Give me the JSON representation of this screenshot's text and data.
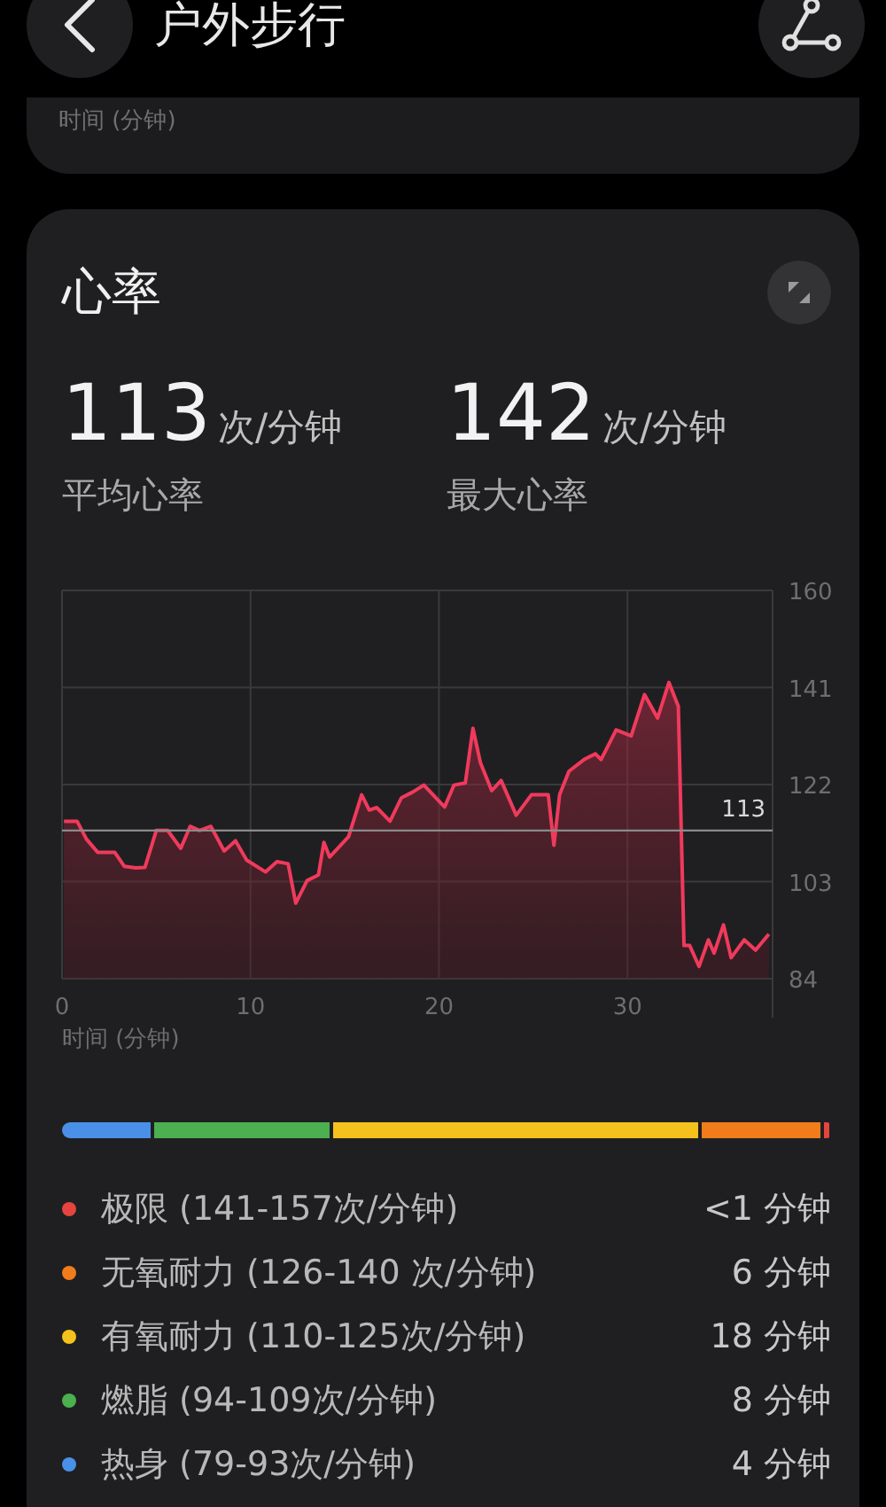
{
  "header": {
    "title": "户外步行"
  },
  "previous_card": {
    "axis_label": "时间 (分钟)"
  },
  "heart_rate_card": {
    "title": "心率",
    "stats": [
      {
        "value": "113",
        "unit": "次/分钟",
        "label": "平均心率"
      },
      {
        "value": "142",
        "unit": "次/分钟",
        "label": "最大心率"
      }
    ],
    "chart_data": {
      "type": "area",
      "xlabel": "时间 (分钟)",
      "xlim": [
        0,
        37.7
      ],
      "ylim": [
        84,
        160
      ],
      "xticks": [
        0,
        10,
        20,
        30
      ],
      "yticks": [
        84,
        103,
        122,
        141,
        160
      ],
      "x": [
        0.1,
        0.8,
        1.3,
        1.9,
        2.8,
        3.3,
        3.9,
        4.4,
        5.0,
        5.6,
        6.3,
        6.8,
        7.3,
        7.9,
        8.6,
        9.2,
        9.8,
        10.8,
        11.4,
        12.0,
        12.4,
        13.0,
        13.6,
        13.9,
        14.2,
        15.2,
        15.9,
        16.3,
        16.7,
        17.4,
        18.0,
        18.6,
        19.2,
        20.3,
        20.8,
        21.4,
        21.8,
        22.2,
        22.8,
        23.3,
        24.1,
        24.9,
        25.8,
        26.1,
        26.4,
        26.9,
        27.7,
        28.3,
        28.6,
        29.4,
        30.2,
        30.9,
        31.6,
        32.2,
        32.7,
        33.0,
        33.3,
        33.8,
        34.3,
        34.6,
        35.1,
        35.5,
        36.2,
        36.8,
        37.5
      ],
      "grid": true,
      "series": [
        {
          "color": "#f03a5c",
          "values": [
            114.8,
            114.8,
            111.3,
            108.7,
            108.7,
            106,
            105.7,
            105.8,
            113,
            113,
            109.5,
            113.8,
            113,
            113.8,
            109,
            111,
            107.2,
            104.9,
            106.9,
            106.5,
            98.8,
            103.2,
            104.3,
            110.7,
            107.8,
            111.8,
            120,
            117,
            117.5,
            114.8,
            119.4,
            120.5,
            121.9,
            117.6,
            121.9,
            122.3,
            133,
            126.3,
            120.8,
            122.8,
            116,
            120,
            120,
            110.1,
            120,
            124.6,
            126.9,
            128,
            126.9,
            132.7,
            131.5,
            139.6,
            135,
            142,
            137.3,
            90.5,
            90.5,
            86.4,
            91.6,
            89,
            94.5,
            88.1,
            91.6,
            89.6,
            92.7
          ]
        }
      ],
      "ref_lines": [
        {
          "axis": "y",
          "value": 113,
          "label": "113"
        }
      ]
    },
    "zones": [
      {
        "label": "极限 (141-157次/分钟)",
        "duration": "<1 分钟",
        "color": "#e5443f"
      },
      {
        "label": "无氧耐力 (126-140 次/分钟)",
        "duration": "6 分钟",
        "color": "#f07c1c"
      },
      {
        "label": "有氧耐力 (110-125次/分钟)",
        "duration": "18 分钟",
        "color": "#f5c11c"
      },
      {
        "label": "燃脂 (94-109次/分钟)",
        "duration": "8 分钟",
        "color": "#4caf50"
      },
      {
        "label": "热身 (79-93次/分钟)",
        "duration": "4 分钟",
        "color": "#4a90e8"
      }
    ]
  }
}
